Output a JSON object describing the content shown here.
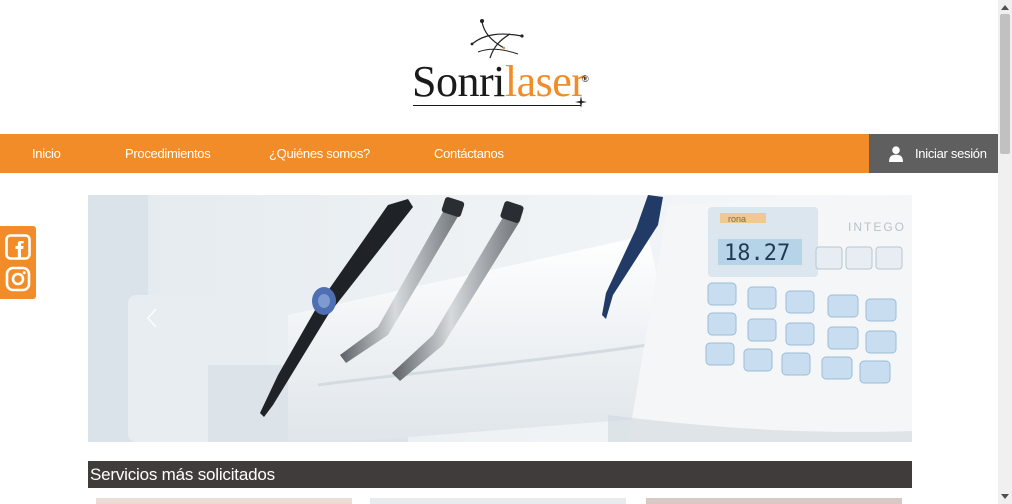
{
  "brand": {
    "name_dark": "Sonri",
    "name_light": "laser",
    "registered": "®",
    "accent": "#f28c28",
    "dark": "#403c3b"
  },
  "nav": {
    "items": [
      {
        "label": "Inicio"
      },
      {
        "label": "Procedimientos"
      },
      {
        "label": "¿Quiénes somos?"
      },
      {
        "label": "Contáctanos"
      }
    ],
    "login_label": "Iniciar sesión",
    "login_icon": "user-icon"
  },
  "social": {
    "items": [
      {
        "icon": "facebook-icon"
      },
      {
        "icon": "instagram-icon"
      }
    ]
  },
  "hero": {
    "display_value": "18.27",
    "panel_brand": "rona",
    "panel_model": "INTEGO",
    "prev_icon": "chevron-left-icon"
  },
  "services": {
    "heading": "Servicios más solicitados"
  }
}
